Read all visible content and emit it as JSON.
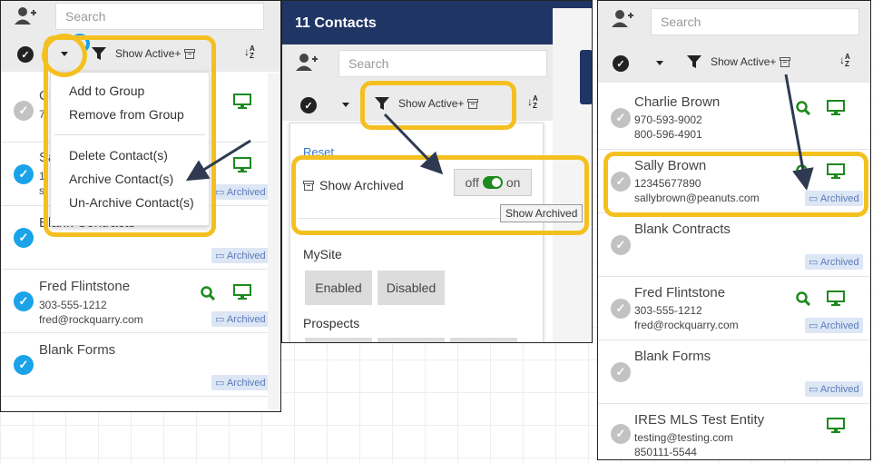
{
  "panel1": {
    "search_placeholder": "Search",
    "filter_label": "Show Active+",
    "menu": {
      "add_to_group": "Add to Group",
      "remove_from_group": "Remove from Group",
      "delete": "Delete Contact(s)",
      "archive": "Archive Contact(s)",
      "unarchive": "Un-Archive Contact(s)"
    },
    "rows": [
      {
        "name": "Ch",
        "sub1": "7",
        "sub2": ""
      },
      {
        "name": "Sa",
        "sub1": "1",
        "sub2": "s",
        "badge": "Archived"
      },
      {
        "name": "Blank Contracts",
        "badge": "Archived"
      },
      {
        "name": "Fred Flintstone",
        "phone": "303-555-1212",
        "email": "fred@rockquarry.com",
        "badge": "Archived"
      },
      {
        "name": "Blank Forms",
        "badge": "Archived"
      }
    ]
  },
  "panel2": {
    "header_title": "11 Contacts",
    "search_placeholder": "Search",
    "filter_label": "Show Active+",
    "reset": "Reset",
    "show_archived": "Show Archived",
    "toggle_off": "off",
    "toggle_on": "on",
    "tooltip": "Show Archived",
    "mysite": "MySite",
    "enabled": "Enabled",
    "disabled": "Disabled",
    "prospects": "Prospects"
  },
  "panel3": {
    "search_placeholder": "Search",
    "filter_label": "Show Active+",
    "rows": [
      {
        "name": "Charlie Brown",
        "line1": "970-593-9002",
        "line2": "800-596-4901"
      },
      {
        "name": "Sally Brown",
        "line1": "12345677890",
        "line2": "sallybrown@peanuts.com",
        "badge": "Archived"
      },
      {
        "name": "Blank Contracts",
        "badge": "Archived"
      },
      {
        "name": "Fred Flintstone",
        "line1": "303-555-1212",
        "line2": "fred@rockquarry.com",
        "badge": "Archived"
      },
      {
        "name": "Blank Forms",
        "badge": "Archived"
      },
      {
        "name": "IRES MLS Test Entity",
        "line1": "testing@testing.com",
        "line2": "850111-5544"
      }
    ]
  },
  "colors": {
    "highlight": "#f4c020",
    "header": "#1f3564",
    "check_blue": "#1aa3e8",
    "icon_green": "#1d8a1d",
    "badge_bg": "#dde6f5"
  }
}
